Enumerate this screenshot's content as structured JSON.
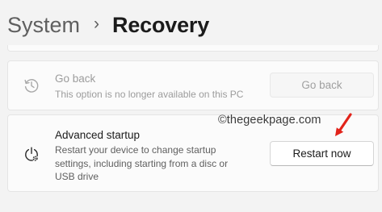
{
  "breadcrumb": {
    "parent": "System",
    "separator": "›",
    "current": "Recovery"
  },
  "go_back": {
    "icon": "history-icon",
    "title": "Go back",
    "description": "This option is no longer available on this PC",
    "button_label": "Go back",
    "enabled": false
  },
  "advanced_startup": {
    "icon": "power-settings-icon",
    "title": "Advanced startup",
    "description_lines": [
      "Restart your device to change startup",
      "settings, including starting from a disc or",
      "USB drive"
    ],
    "button_label": "Restart now"
  },
  "watermark": "©thegeekpage.com",
  "colors": {
    "background": "#f3f3f3",
    "card": "#fbfbfb",
    "annotation_arrow": "#e2231a"
  }
}
